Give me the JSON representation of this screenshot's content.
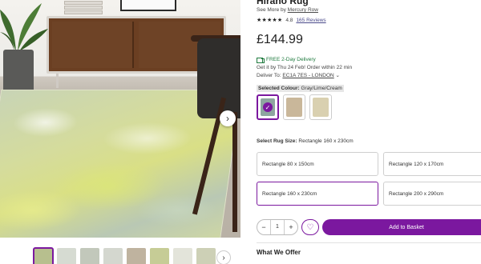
{
  "product": {
    "title": "Hirano Rug",
    "see_more_prefix": "See More by",
    "brand": "Mercury Row",
    "rating_value": "4.8",
    "rating_stars": "★★★★★",
    "reviews_label": "165 Reviews",
    "price": "£144.99"
  },
  "delivery": {
    "free_label": "FREE 2-Day Delivery",
    "get_it_by": "Get it by Thu 24 Feb! Order within 22 min",
    "deliver_to_label": "Deliver To:",
    "deliver_to_location": "EC1A 7ES - LONDON",
    "chevron": "⌄"
  },
  "colour": {
    "label": "Selected Colour:",
    "value": "Gray/Lime/Cream",
    "swatches": [
      {
        "color": "#8ea6a0",
        "selected": true
      },
      {
        "color": "#c9b79a",
        "selected": false
      },
      {
        "color": "#d9d0b0",
        "selected": false
      }
    ]
  },
  "size": {
    "label": "Select Rug Size:",
    "value": "Rectangle 160 x 230cm",
    "options": [
      "Rectangle 80 x 150cm",
      "Rectangle 120 x 170cm",
      "Rectangle 160 x 230cm",
      "Rectangle 200 x 290cm"
    ],
    "selected_index": 2
  },
  "purchase": {
    "qty_minus": "−",
    "qty_value": "1",
    "qty_plus": "+",
    "favourite_icon": "♡",
    "add_to_basket": "Add to Basket"
  },
  "gallery": {
    "next_arrow": "›",
    "thumbnails": [
      {
        "color": "#b7bf8e",
        "active": true
      },
      {
        "color": "#d6dbd2",
        "active": false
      },
      {
        "color": "#c2c8bb",
        "active": false
      },
      {
        "color": "#d4d7cf",
        "active": false
      },
      {
        "color": "#bfb39f",
        "active": false
      },
      {
        "color": "#c6cc96",
        "active": false
      },
      {
        "color": "#e3e4da",
        "active": false
      },
      {
        "color": "#cdd0b6",
        "active": false
      }
    ]
  },
  "section": {
    "what_we_offer": "What We Offer"
  },
  "colors": {
    "accent": "#7b189f",
    "delivery_green": "#1f7a3e"
  }
}
